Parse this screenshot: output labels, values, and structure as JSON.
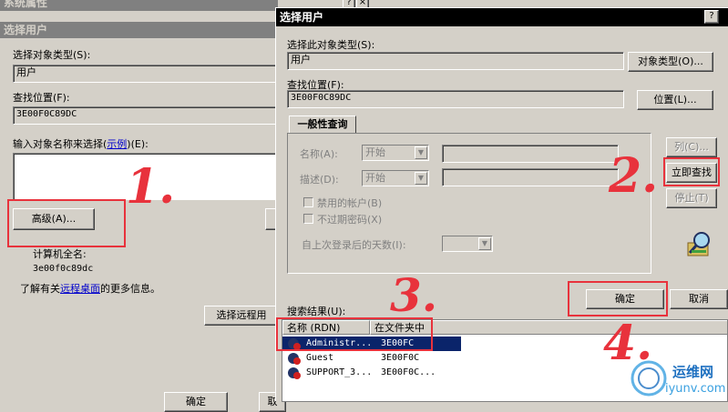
{
  "back": {
    "title": "系统属性",
    "dialog_title": "选择用户",
    "object_type_label": "选择对象类型(S):",
    "object_type_value": "用户",
    "location_label": "查找位置(F):",
    "location_value": "3E00F0C89DC",
    "enter_names_label_pre": "输入对象名称来选择(",
    "enter_names_link": "示例",
    "enter_names_label_post": ")(E):",
    "advanced_button": "高级(A)...",
    "computer_name_label": "计算机全名:",
    "computer_name_value": "3e00f0c89dc",
    "more_info_pre": "了解有关",
    "remote_desktop_link": "远程桌面",
    "more_info_post": "的更多信息。",
    "select_remote_button": "选择远程用",
    "ok_button": "确定",
    "cancel_button": "取"
  },
  "front": {
    "title": "选择用户",
    "object_type_label": "选择此对象类型(S):",
    "object_type_value": "用户",
    "object_types_button": "对象类型(O)...",
    "location_label": "查找位置(F):",
    "location_value": "3E00F0C89DC",
    "locations_button": "位置(L)...",
    "tab_label": "一般性查询",
    "name_label": "名称(A):",
    "name_combo": "开始",
    "description_label": "描述(D):",
    "description_combo": "开始",
    "disabled_accounts": "禁用的帐户(B)",
    "nonexpiring_password": "不过期密码(X)",
    "days_since_logon": "自上次登录后的天数(I):",
    "columns_button": "列(C)...",
    "find_now_button": "立即查找",
    "stop_button": "停止(T)",
    "search_results_label": "搜索结果(U):",
    "ok_button": "确定",
    "cancel_button": "取消",
    "columns": [
      "名称 (RDN)",
      "在文件夹中"
    ],
    "rows": [
      {
        "name": "Administr...",
        "folder": "3E00FC"
      },
      {
        "name": "Guest",
        "folder": "3E00F0C"
      },
      {
        "name": "SUPPORT_3...",
        "folder": "3E00F0C..."
      }
    ]
  },
  "annotations": [
    "1.",
    "2.",
    "3.",
    "4."
  ],
  "watermark": {
    "brand": "运维网",
    "url": "iyunv.com"
  },
  "colors": {
    "annotation_red": "#e8323c",
    "selection_blue": "#0a246a"
  }
}
